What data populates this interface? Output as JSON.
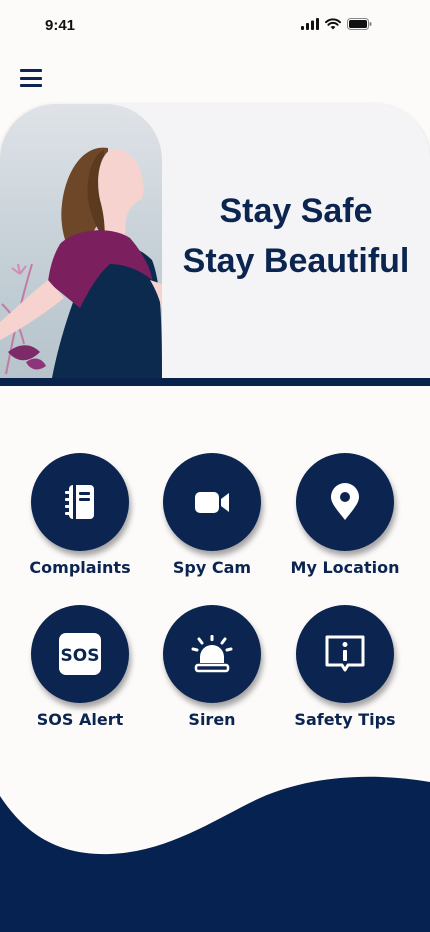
{
  "status_bar": {
    "time": "9:41"
  },
  "hero": {
    "title_line1": "Stay Safe",
    "title_line2": "Stay Beautiful"
  },
  "features": [
    {
      "label": "Complaints",
      "icon": "notebook-icon"
    },
    {
      "label": "Spy Cam",
      "icon": "video-camera-icon"
    },
    {
      "label": "My Location",
      "icon": "location-pin-icon"
    },
    {
      "label": "SOS Alert",
      "icon": "sos-icon",
      "icon_text": "SOS"
    },
    {
      "label": "Siren",
      "icon": "siren-icon"
    },
    {
      "label": "Safety Tips",
      "icon": "info-message-icon"
    }
  ],
  "colors": {
    "primary": "#0b2550",
    "background": "#fdfbfa",
    "card": "#f4f4f6"
  }
}
